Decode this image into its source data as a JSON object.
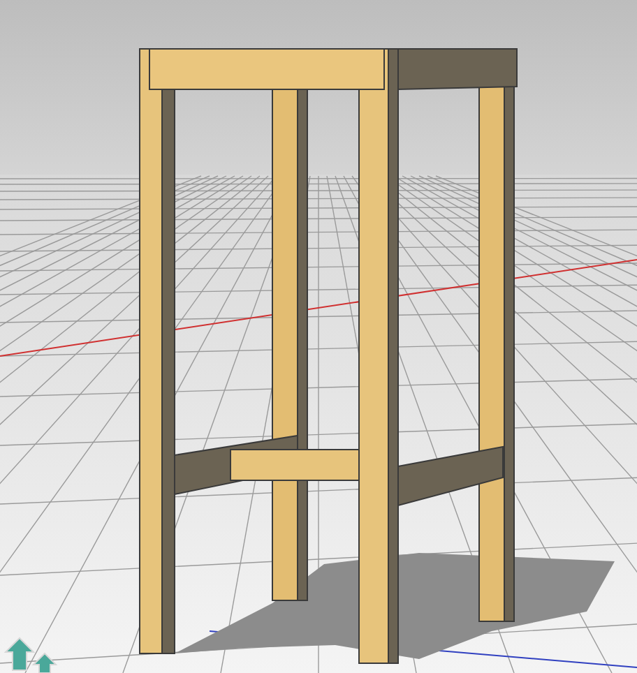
{
  "viewport": {
    "show_grid": true,
    "show_axes": true,
    "show_shadows": true
  }
}
